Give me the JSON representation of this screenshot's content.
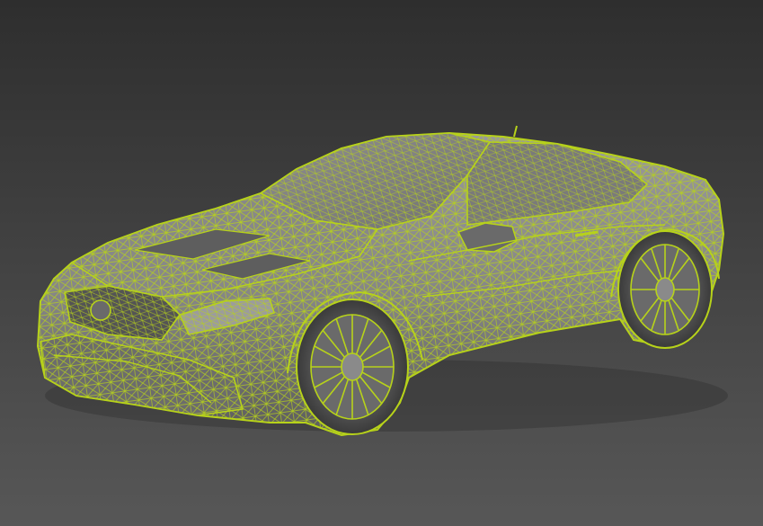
{
  "viewport": {
    "mode": "wireframe-over-shaded",
    "background_top": "#2e2e2e",
    "background_bottom": "#575757",
    "body_color": "#8a8a8a",
    "body_shade": "#6f6f6f",
    "wire_color": "#b7d21a",
    "wire_dark": "#7e9710",
    "shadow_color": "#1c1c1c"
  },
  "model": {
    "name": "car-wireframe-model",
    "subject": "sports coupe"
  }
}
